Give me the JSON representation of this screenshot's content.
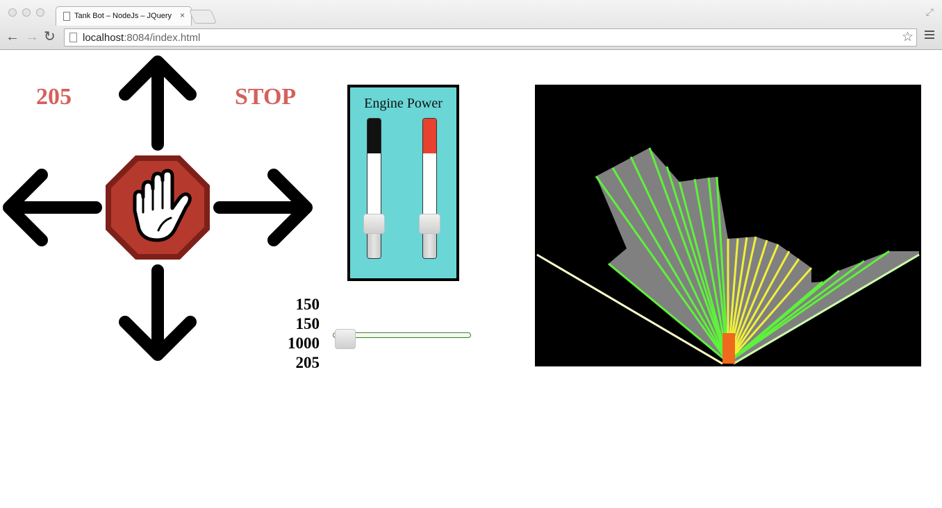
{
  "browser": {
    "tab_title": "Tank Bot – NodeJs – JQuery",
    "tab_close": "×",
    "url_host": "localhost",
    "url_path": ":8084/index.html",
    "back_glyph": "←",
    "forward_glyph": "→",
    "reload_glyph": "↻",
    "star_glyph": "☆",
    "expand_glyph": "⤢"
  },
  "controls": {
    "speed_value": "205",
    "status": "STOP",
    "up_icon": "arrow-up-icon",
    "down_icon": "arrow-down-icon",
    "left_icon": "arrow-left-icon",
    "right_icon": "arrow-right-icon",
    "stop_icon": "stop-hand-icon"
  },
  "engine_power": {
    "title": "Engine Power",
    "left_fill_color": "#111111",
    "right_fill_color": "#e8412f"
  },
  "readouts": [
    "150",
    "150",
    "1000",
    "205"
  ],
  "colors": {
    "label_red": "#d4615d",
    "panel_cyan": "#6ad6d6",
    "stop_red": "#b03a2e",
    "radar_bg": "#000000",
    "radar_fill": "#808080",
    "ray_green": "#5ef23a",
    "ray_yellow": "#f0f03a",
    "robot_orange": "#f06a1e"
  }
}
